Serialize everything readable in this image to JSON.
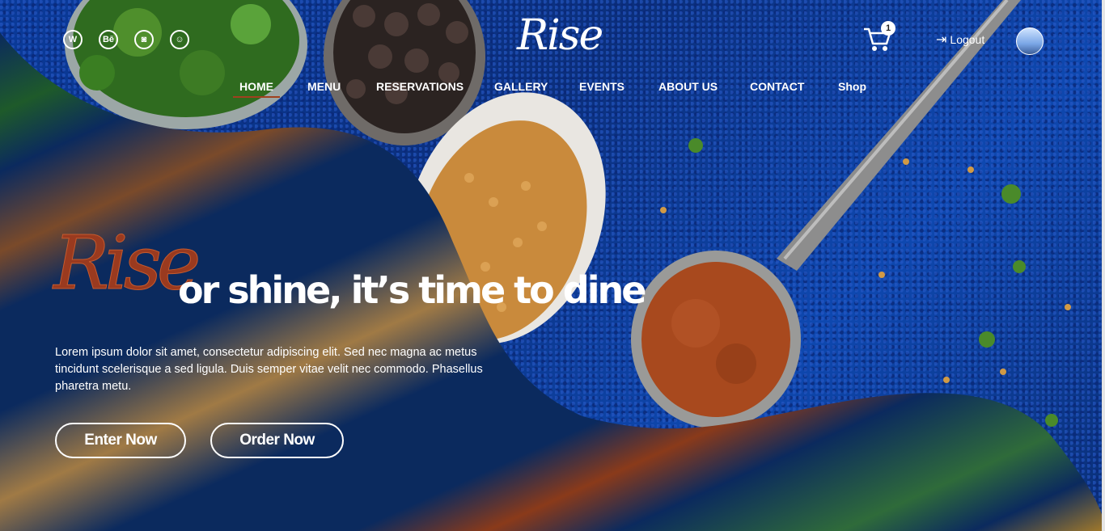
{
  "header": {
    "logo": "Rise",
    "social_icons": [
      "vk-icon",
      "behance-icon",
      "instagram-icon",
      "snapchat-icon"
    ],
    "cart_count": "1",
    "logout_label": "Logout"
  },
  "nav": [
    {
      "label": "HOME"
    },
    {
      "label": "MENU"
    },
    {
      "label": "RESERVATIONS"
    },
    {
      "label": "GALLERY"
    },
    {
      "label": "EVENTS"
    },
    {
      "label": "ABOUT US"
    },
    {
      "label": "CONTACT"
    },
    {
      "label": "Shop"
    }
  ],
  "hero": {
    "brand_word": "Rise",
    "tagline": "or shine, it’s time to dine",
    "description": "Lorem ipsum dolor sit amet, consectetur adipiscing elit. Sed nec magna ac metus tincidunt scelerisque a sed ligula. Duis semper vitae velit nec commodo. Phasellus pharetra metu.",
    "enter_label": "Enter Now",
    "order_label": "Order Now"
  },
  "colors": {
    "accent": "#9a3a1f",
    "navy": "#0a2a63",
    "spice_blue": "#0e48b0"
  }
}
